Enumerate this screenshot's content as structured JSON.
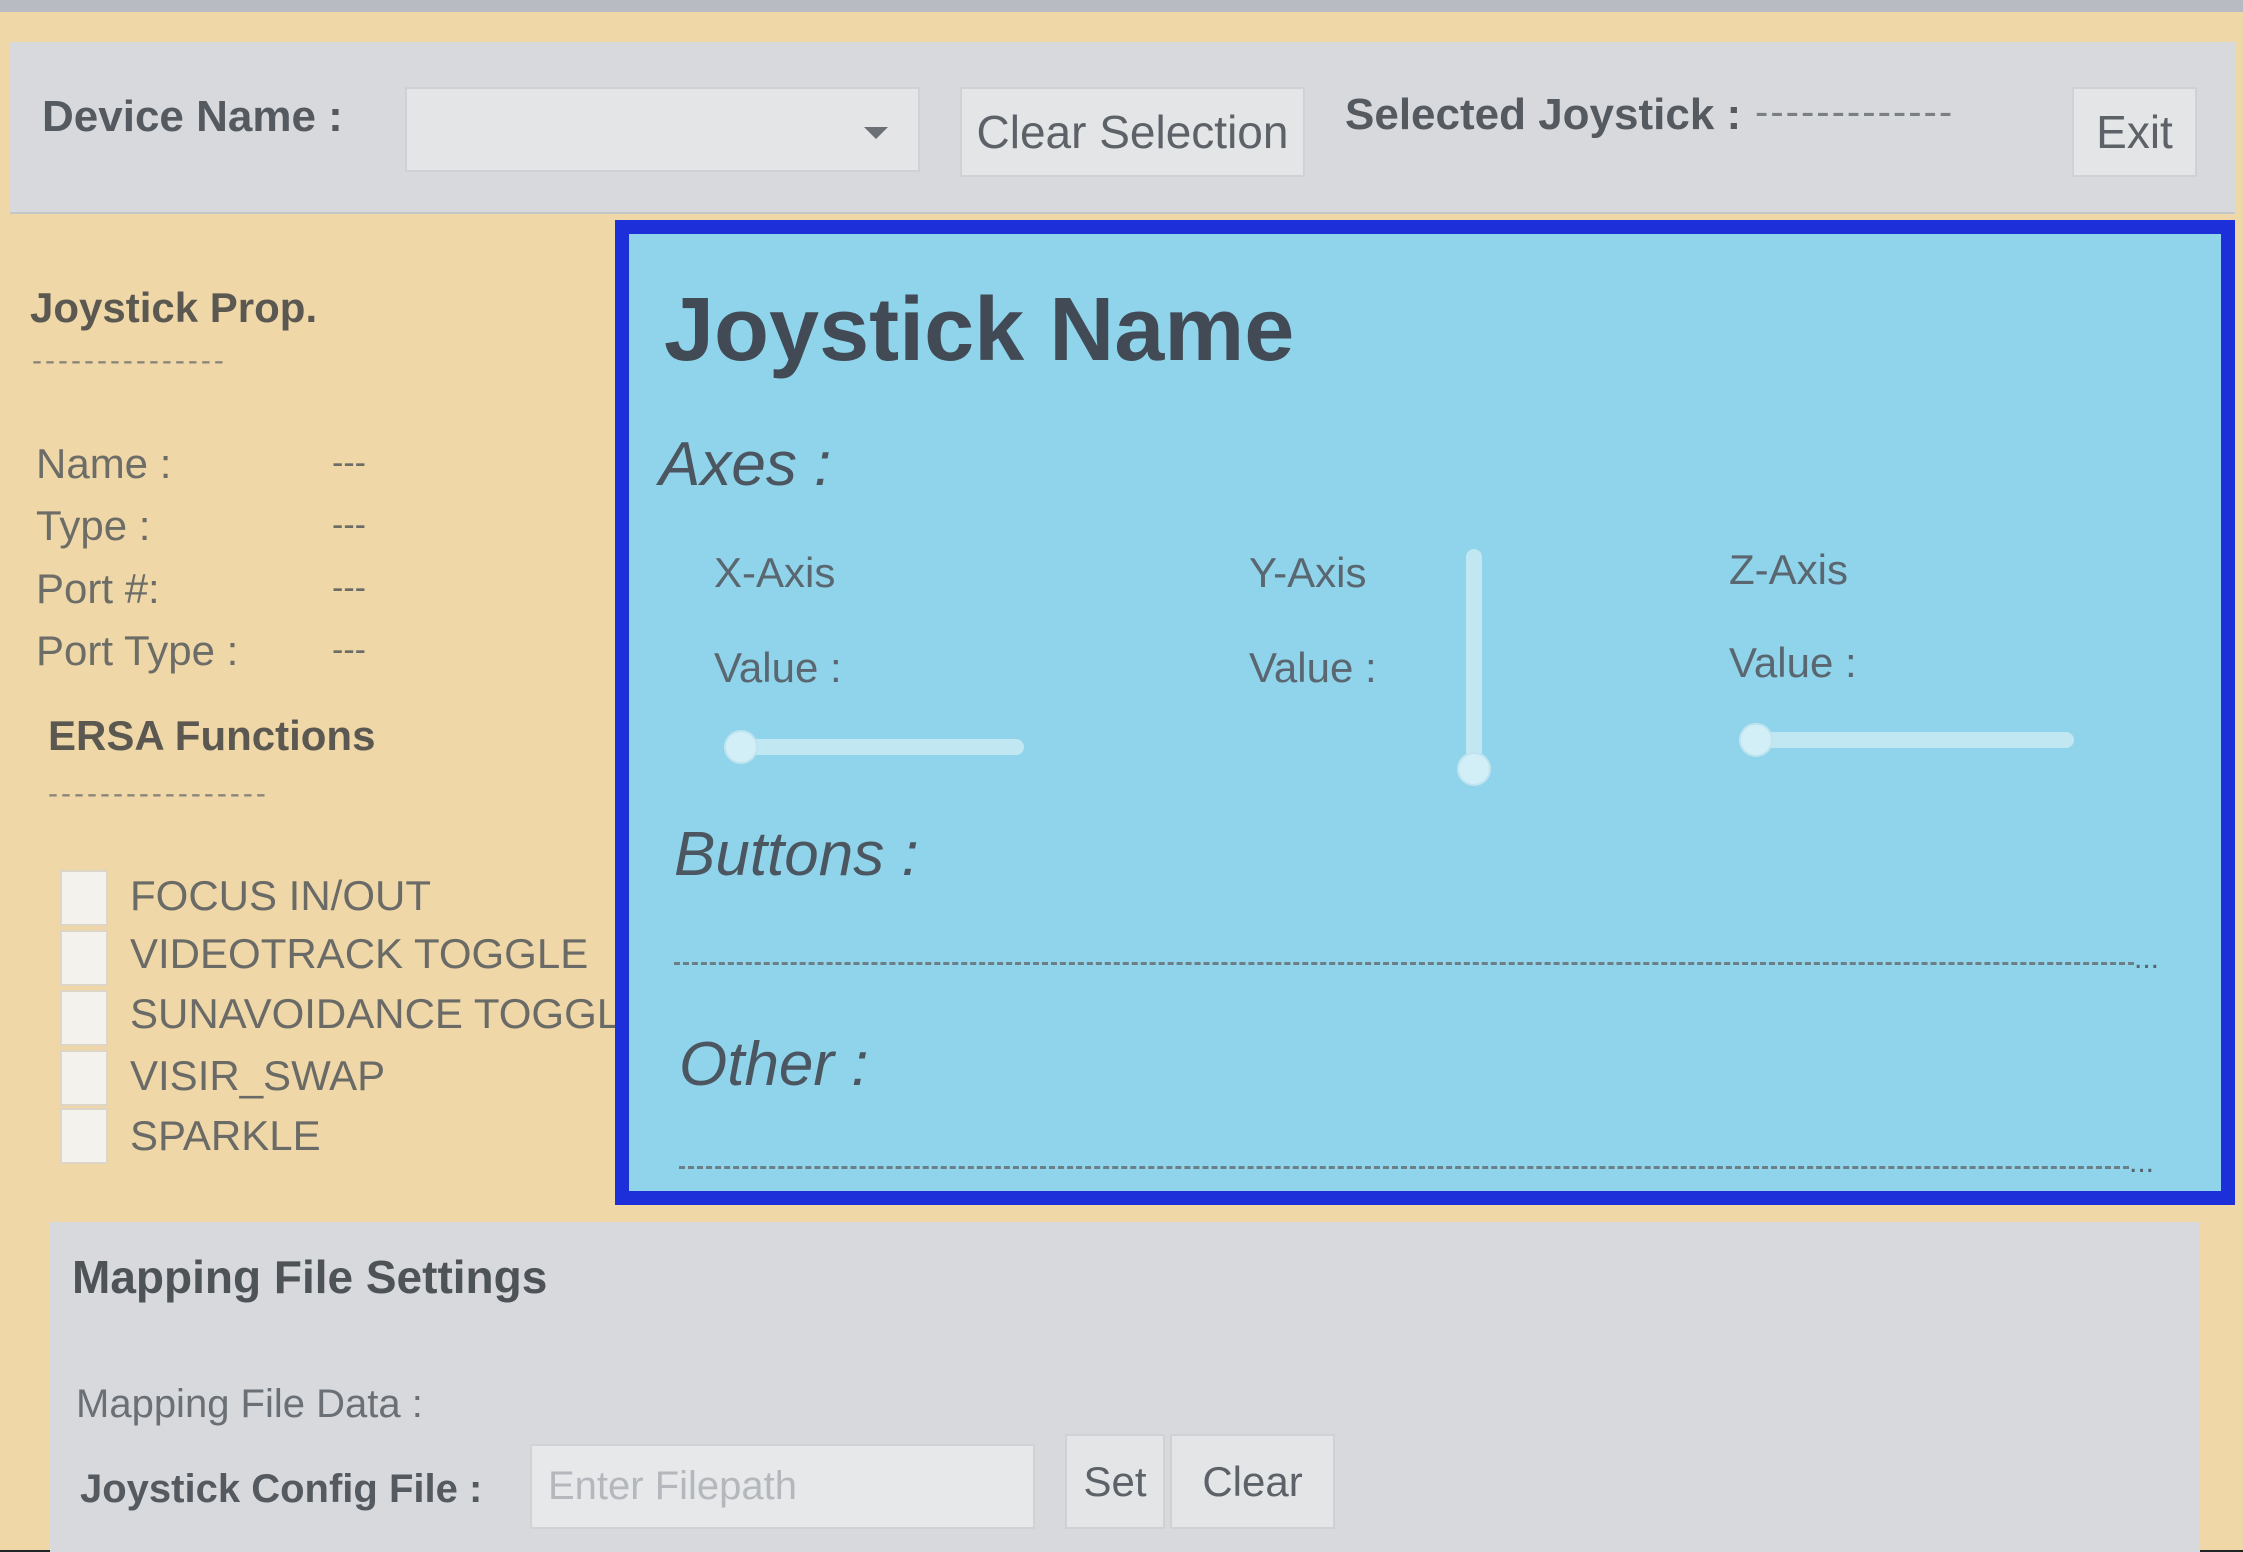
{
  "topbar": {
    "device_name_label": "Device Name :",
    "device_dropdown_value": "",
    "clear_selection_label": "Clear Selection",
    "selected_joystick_label": "Selected Joystick :",
    "selected_joystick_value": "-------------",
    "exit_label": "Exit"
  },
  "properties": {
    "title": "Joystick Prop.",
    "title_underline": "---------------",
    "rows": [
      {
        "label": "Name :",
        "value": "---"
      },
      {
        "label": "Type :",
        "value": "---"
      },
      {
        "label": "Port #:",
        "value": "---"
      },
      {
        "label": "Port Type :",
        "value": "---"
      }
    ]
  },
  "ersa": {
    "title": "ERSA Functions",
    "title_underline": "-----------------",
    "functions": [
      {
        "label": "FOCUS IN/OUT",
        "checked": false
      },
      {
        "label": "VIDEOTRACK TOGGLE",
        "checked": false
      },
      {
        "label": "SUNAVOIDANCE TOGGLE",
        "checked": false
      },
      {
        "label": "VISIR_SWAP",
        "checked": false
      },
      {
        "label": "SPARKLE",
        "checked": false
      }
    ]
  },
  "joystick": {
    "name": "Joystick Name",
    "axes_title": "Axes :",
    "axes": [
      {
        "label": "X-Axis",
        "value_label": "Value :",
        "slider_value": 0
      },
      {
        "label": "Y-Axis",
        "value_label": "Value :",
        "slider_value": 0
      },
      {
        "label": "Z-Axis",
        "value_label": "Value :",
        "slider_value": 0
      }
    ],
    "buttons_title": "Buttons :",
    "other_title": "Other :",
    "ellipsis": "..."
  },
  "mapping": {
    "title": "Mapping File Settings",
    "data_label": "Mapping File Data :",
    "config_file_label": "Joystick Config File :",
    "filepath_placeholder": "Enter Filepath",
    "filepath_value": "",
    "set_label": "Set",
    "clear_label": "Clear"
  },
  "colors": {
    "app_background": "#efd7a8",
    "panel_gray": "#d7d9dc",
    "joystick_panel": "#8fd4ea",
    "joystick_border": "#1c2fd8"
  }
}
